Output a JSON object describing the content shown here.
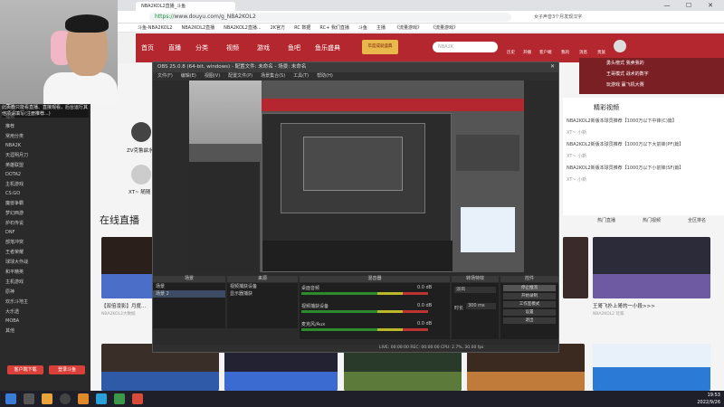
{
  "browser": {
    "tab_title": "NBA2KOL2直播_斗鱼",
    "url_secure": "https://",
    "url_rest": "www.douyu.com/g_NBA2KOL2",
    "side_search": "女子声音3个月发现汉字",
    "window_controls": [
      "—",
      "☐",
      "✕"
    ],
    "bookmarks": [
      "斗鱼-NBA2KOL2",
      "NBA2KOL2直播",
      "NBA2KOL2直播...",
      "2K官方",
      "RC 数据",
      "RC+ 我们直播",
      "斗鱼",
      "主播",
      "《流量游戏》",
      "《流量游戏》"
    ]
  },
  "nav": {
    "items": [
      "首页",
      "直播",
      "分类",
      "视频",
      "游戏",
      "鱼吧",
      "鱼乐盛典"
    ],
    "search_placeholder": "NBA2K",
    "badge": "年度成就盛典",
    "right_items": [
      "历史",
      "开播",
      "客户端",
      "我的",
      "消息",
      "贵族",
      "小葫芦"
    ]
  },
  "webcam_overlay_text": "此页面只能看直播、直接观看，后台运行其他项请填写(注册推荐...)",
  "left_panel": {
    "items": [
      "直播",
      "视频",
      "推荐",
      "常用分类",
      "NBA2K",
      "天涯明月刀",
      "英雄联盟",
      "DOTA2",
      "主机游戏",
      "CS:GO",
      "魔兽争霸",
      "梦幻西游",
      "炉石传说",
      "DNF",
      "部落冲突",
      "王者荣耀",
      "球球大作战",
      "和平精英",
      "主机游戏",
      "原神",
      "欢乐斗地主",
      "大乐透",
      "MOBA",
      "其他"
    ],
    "btn_client": "客户端下载",
    "btn_login": "登录斗鱼"
  },
  "main": {
    "live_heading": "在线直播",
    "card_titles": [
      "【双倍凌影】月度...",
      "王哥飞扑上哥的一小段>>>"
    ],
    "card_sub": [
      "NBA2KOL2大数据",
      "NBA2KOL2 玩家"
    ],
    "top_name": "ZV克鲁兹水",
    "top_sub": "XT~ 随随"
  },
  "right_col": {
    "heading": "精彩视频",
    "items": [
      "NBA2KOL2新版本球员推荐【1000万以下中锋(C)篇】",
      "NBA2KOL2新版本球员推荐【1000万以下大前锋(PF)篇】",
      "NBA2KOL2新版本球员推荐【1000万以下小前锋(SF)篇】"
    ],
    "meta": [
      "XT~ 小新",
      "XT~ 小新",
      "XT~ 小新"
    ],
    "hot": [
      "热门直播",
      "热门视频",
      "全区排名"
    ],
    "top_links": [
      "勇头榜式 我卖我的",
      "王哥模式 战术的数字",
      "玩游戏 赢飞机大赛"
    ]
  },
  "obs": {
    "title": "OBS 25.0.8 (64-bit, windows) - 配置文件: 未命名 - 场景: 未命名",
    "menu": [
      "文件(F)",
      "编辑(E)",
      "视图(V)",
      "配置文件(P)",
      "场景集合(S)",
      "工具(T)",
      "帮助(H)"
    ],
    "panels": [
      "场景",
      "来源",
      "混音器",
      "转场特效",
      "控件"
    ],
    "scenes": [
      "场景",
      "场景 2"
    ],
    "sources": [
      "视频捕获设备",
      "显示器捕获"
    ],
    "mixer": [
      {
        "name": "桌面音频",
        "level": "0.0 dB"
      },
      {
        "name": "视频捕获设备",
        "level": "0.0 dB"
      },
      {
        "name": "麦克风/Aux",
        "level": "0.0 dB"
      }
    ],
    "transition": {
      "label": "淡出",
      "duration_label": "时长",
      "duration": "300 ms"
    },
    "controls": [
      "停止推流",
      "开始录制",
      "工作室模式",
      "设置",
      "退出"
    ],
    "status": "LIVE: 00:00:00    REC: 00:00:00    CPU: 2.7%, 30.00 fps"
  },
  "taskbar": {
    "time": "19:53",
    "date": "2022/9/26"
  },
  "colors": {
    "brand_red": "#b5272e",
    "obs_dark": "#2b2b2b"
  }
}
